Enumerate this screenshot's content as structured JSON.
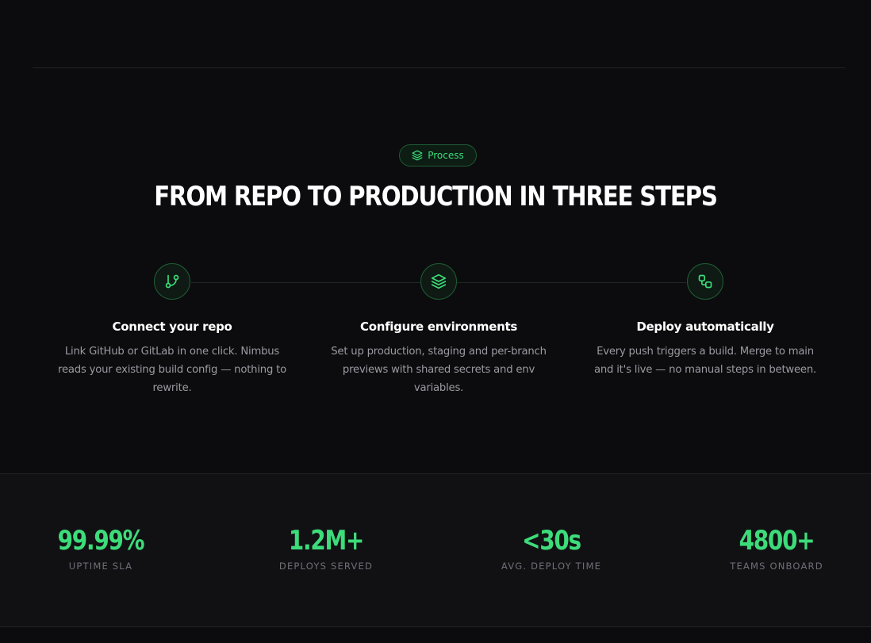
{
  "badge": {
    "label": "Process",
    "icon": "layers-icon"
  },
  "headline": "FROM REPO TO PRODUCTION IN THREE STEPS",
  "accent_color": "#3ddc7a",
  "steps": [
    {
      "icon": "git-branch-icon",
      "title": "Connect your repo",
      "description": "Link GitHub or GitLab in one click. Nimbus reads your existing build config — nothing to rewrite."
    },
    {
      "icon": "layers-icon",
      "title": "Configure environments",
      "description": "Set up production, staging and per-branch previews with shared secrets and env variables."
    },
    {
      "icon": "workflow-icon",
      "title": "Deploy automatically",
      "description": "Every push triggers a build. Merge to main and it's live — no manual steps in between."
    }
  ],
  "stats": [
    {
      "value": "99.99%",
      "label": "UPTIME SLA"
    },
    {
      "value": "1.2M+",
      "label": "DEPLOYS SERVED"
    },
    {
      "value": "<30s",
      "label": "AVG. DEPLOY TIME"
    },
    {
      "value": "4800+",
      "label": "TEAMS ONBOARD"
    }
  ]
}
